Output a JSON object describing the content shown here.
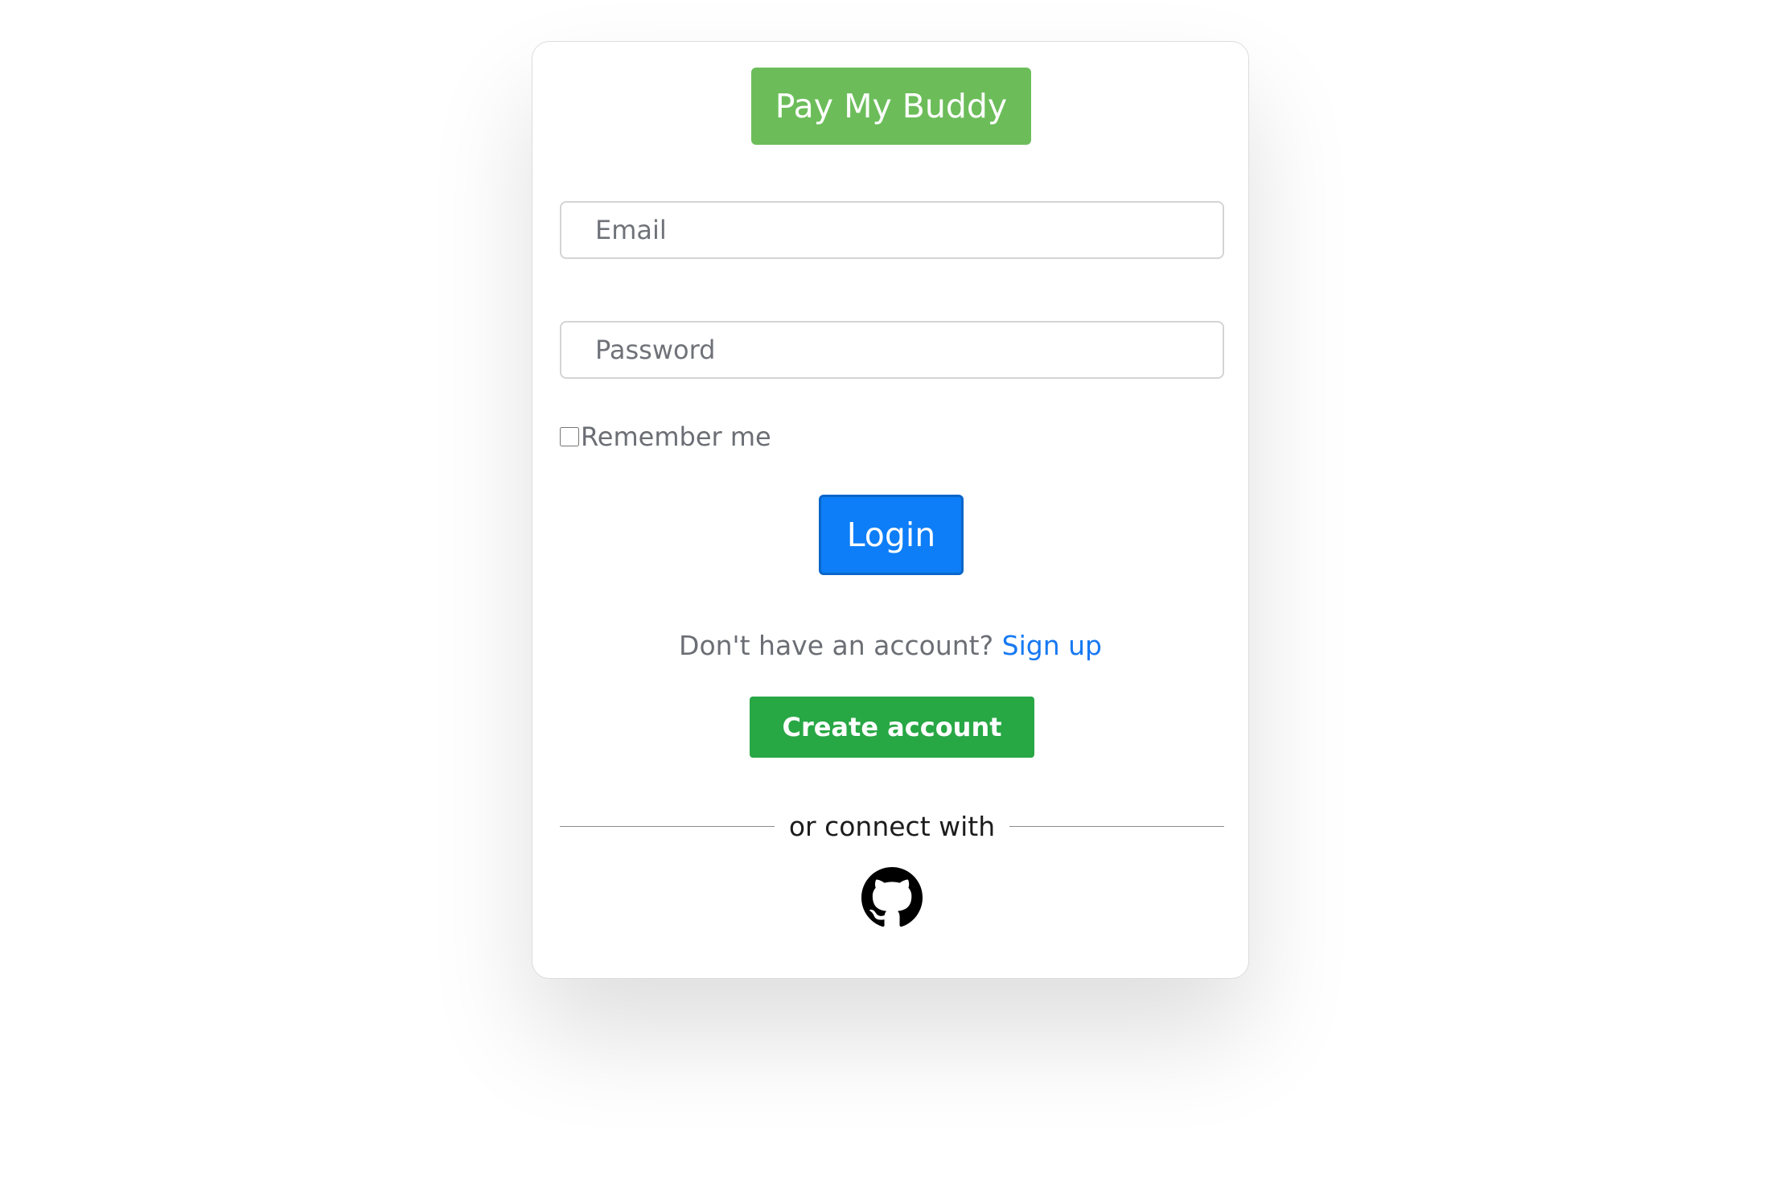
{
  "brand": {
    "title": "Pay My Buddy"
  },
  "form": {
    "email_placeholder": "Email",
    "password_placeholder": "Password",
    "remember_label": "Remember me",
    "remember_checked": false,
    "login_label": "Login"
  },
  "signup": {
    "prompt": "Don't have an account?",
    "link_label": "Sign up",
    "create_label": "Create account"
  },
  "social": {
    "divider_text": "or connect with",
    "providers": [
      {
        "icon": "github-icon"
      }
    ]
  },
  "colors": {
    "brand": "#6cbd5a",
    "primary": "#0d7ef7",
    "success": "#28a745",
    "link": "#1779f2"
  }
}
